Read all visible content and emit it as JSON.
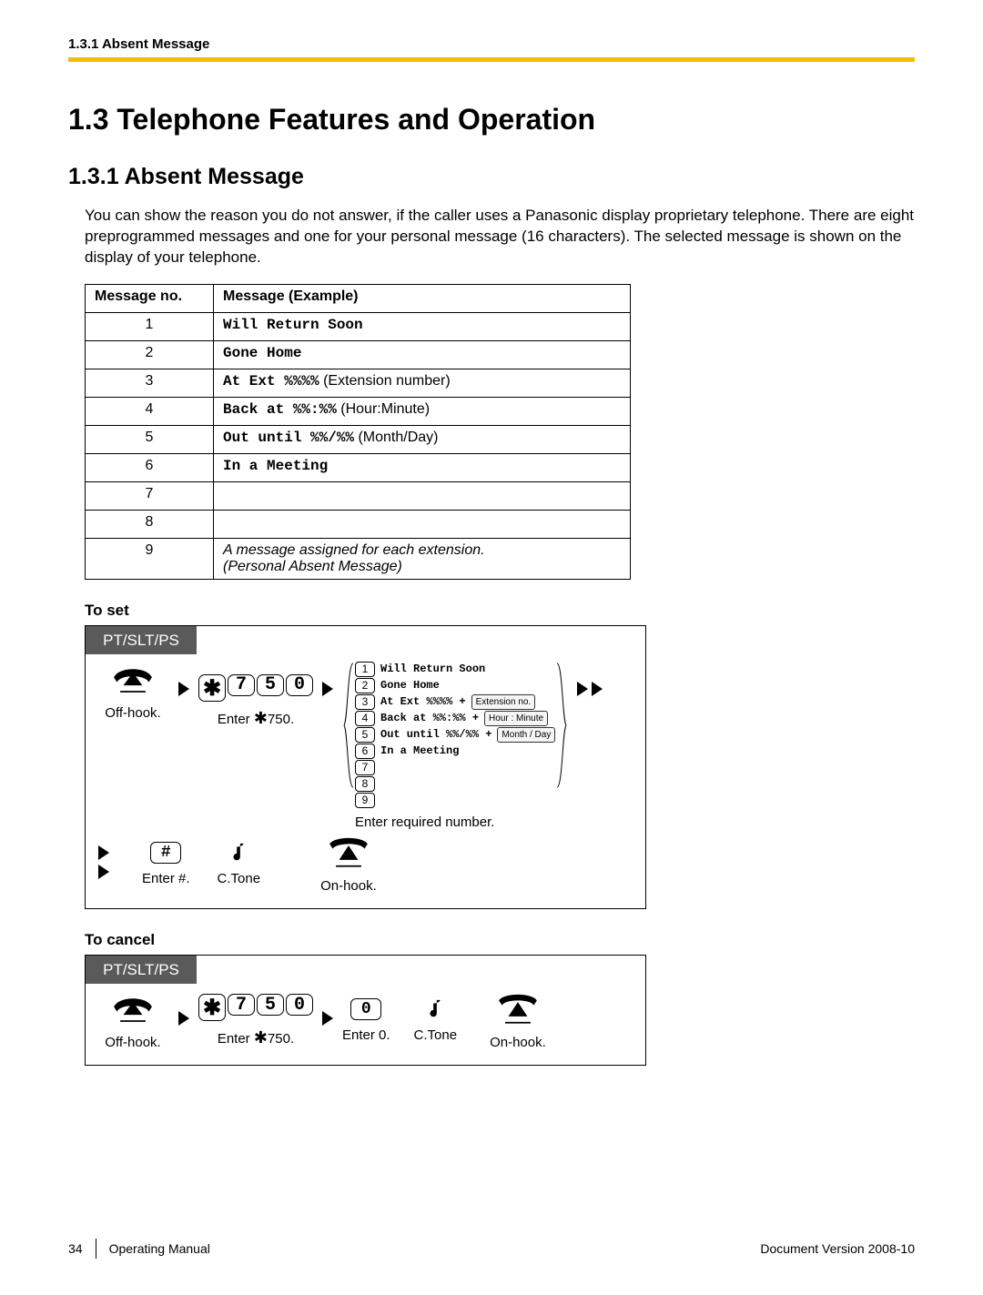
{
  "header": {
    "breadcrumb": "1.3.1 Absent Message"
  },
  "section": {
    "title": "1.3  Telephone Features and Operation"
  },
  "subsection": {
    "title": "1.3.1  Absent Message"
  },
  "intro": "You can show the reason you do not answer, if the caller uses a Panasonic display proprietary telephone. There are eight preprogrammed messages and one for your personal message (16 characters). The selected message is shown on the display of your telephone.",
  "table": {
    "h1": "Message no.",
    "h2": "Message (Example)",
    "rows": [
      {
        "no": "1",
        "mono": "Will Return Soon",
        "tail": ""
      },
      {
        "no": "2",
        "mono": "Gone Home",
        "tail": ""
      },
      {
        "no": "3",
        "mono": "At Ext %%%%",
        "tail": " (Extension number)"
      },
      {
        "no": "4",
        "mono": "Back at %%:%%",
        "tail": " (Hour:Minute)"
      },
      {
        "no": "5",
        "mono": "Out until %%/%%",
        "tail": " (Month/Day)"
      },
      {
        "no": "6",
        "mono": "In a Meeting",
        "tail": ""
      },
      {
        "no": "7",
        "mono": "",
        "tail": ""
      },
      {
        "no": "8",
        "mono": "",
        "tail": ""
      },
      {
        "no": "9",
        "mono": "",
        "tail": "",
        "italic": "A message assigned for each extension.\n(Personal Absent Message)"
      }
    ]
  },
  "toset": {
    "heading": "To set"
  },
  "tocancel": {
    "heading": "To cancel"
  },
  "tab": "PT/SLT/PS",
  "labels": {
    "offhook": "Off-hook.",
    "onhook": "On-hook.",
    "enter750": "Enter    750.",
    "enter750star": "✱",
    "enterhash": "Enter #.",
    "ctone": "C.Tone",
    "enter_req": "Enter required number.",
    "enter0": "Enter 0."
  },
  "code_digits": [
    "✱",
    "7",
    "5",
    "0"
  ],
  "hash": "#",
  "zero": "0",
  "opts": {
    "r1": {
      "n": "1",
      "t": "Will Return Soon"
    },
    "r2": {
      "n": "2",
      "t": "Gone Home"
    },
    "r3": {
      "n": "3",
      "t": "At Ext %%%% +",
      "p": "Extension no."
    },
    "r4": {
      "n": "4",
      "t": "Back at %%:%% +",
      "p": "Hour : Minute"
    },
    "r5": {
      "n": "5",
      "t": "Out until %%/%% +",
      "p": "Month / Day"
    },
    "r6": {
      "n": "6",
      "t": "In a Meeting"
    },
    "r7": {
      "n": "7",
      "t": ""
    },
    "r8": {
      "n": "8",
      "t": ""
    },
    "r9": {
      "n": "9",
      "t": ""
    }
  },
  "footer": {
    "page": "34",
    "manual": "Operating Manual",
    "doc": "Document Version  2008-10"
  }
}
